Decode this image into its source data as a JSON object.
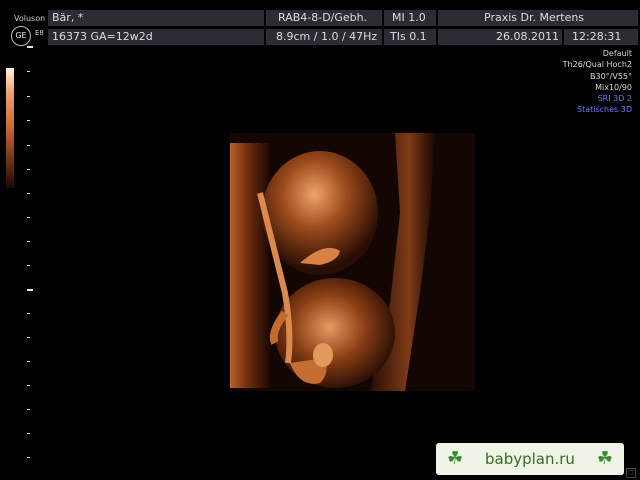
{
  "header": {
    "brand": "Voluson",
    "model": "E8",
    "logo": "GE",
    "patient_name": "Bär, *",
    "patient_id_ga": "16373  GA=12w2d",
    "probe": "RAB4-8-D/Gebh.",
    "depth_info": "8.9cm / 1.0 / 47Hz",
    "mi": "MI  1.0",
    "tis": "TIs  0.1",
    "clinic": "Praxis Dr. Mertens",
    "date": "26.08.2011",
    "time": "12:28:31"
  },
  "settings": {
    "line1": "Default",
    "line2": "Th26/Qual Hoch2",
    "line3": "B30°/V55°",
    "line4": "Mix10/90",
    "line5": "SRI 3D 2",
    "line6": "Statisches 3D",
    "line5_color": "#6d78ff",
    "line6_color": "#6d78ff"
  },
  "watermark": {
    "text": "babyplan.ru",
    "icon_left": "clover-icon",
    "icon_right": "clover-icon"
  },
  "colors": {
    "header_bg": "#2a2d33",
    "sepia_bright": "#f4b07a",
    "sepia_dark": "#5a230a"
  }
}
